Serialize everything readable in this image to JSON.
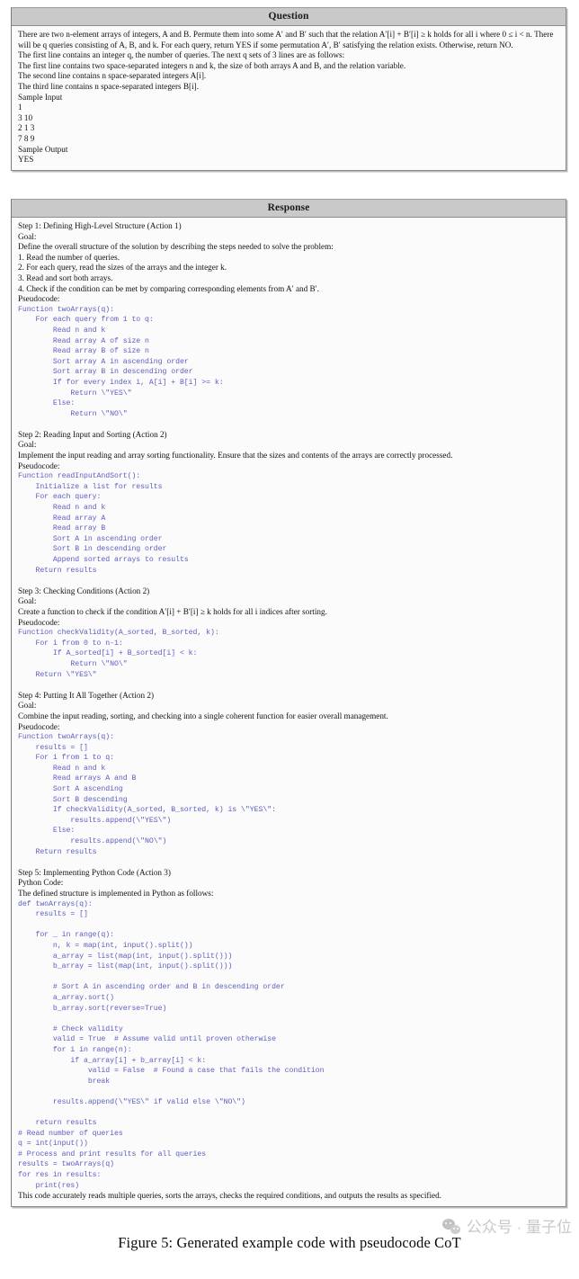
{
  "question": {
    "header": "Question",
    "paragraphs": [
      "There are two n-element arrays of integers, A and B. Permute them into some A′ and B′ such that the relation A′[i] + B′[i] ≥ k holds for all i where 0 ≤ i < n. There will be q queries consisting of A, B, and k. For each query, return YES if some permutation  A′, B′  satisfying the relation exists.  Otherwise, return NO.",
      "The first line contains an integer q, the number of queries. The next q sets of 3 lines are as follows:",
      "The first line contains two space-separated integers n and k, the size of both arrays A and B, and the relation variable.",
      "The second line contains n space-separated integers A[i].",
      "The third line contains n space-separated integers B[i]."
    ],
    "sample_input_label": "Sample Input",
    "sample_input_lines": [
      "1",
      "3 10",
      "2 1 3",
      "7 8 9"
    ],
    "sample_output_label": "Sample Output",
    "sample_output_lines": [
      "YES"
    ]
  },
  "response": {
    "header": "Response",
    "steps": [
      {
        "title": "Step 1: Defining High-Level Structure (Action 1)",
        "goal_label": "Goal:",
        "goal_lines": [
          "Define the overall structure of the solution by describing the steps needed to solve the problem:",
          "1. Read the number of queries.",
          "2. For each query, read the sizes of the arrays and the integer k.",
          "3. Read and sort both arrays.",
          "4. Check if the condition can be met by comparing corresponding elements from A′ and B′."
        ],
        "code_label": "Pseudocode:",
        "code": "Function twoArrays(q):\n    For each query from 1 to q:\n        Read n and k\n        Read array A of size n\n        Read array B of size n\n        Sort array A in ascending order\n        Sort array B in descending order\n        If for every index i, A[i] + B[i] >= k:\n            Return \\\"YES\\\"\n        Else:\n            Return \\\"NO\\\""
      },
      {
        "title": "Step 2: Reading Input and Sorting (Action 2)",
        "goal_label": "Goal:",
        "goal_lines": [
          "Implement the input reading and array sorting functionality. Ensure that the sizes and contents of the arrays are correctly processed."
        ],
        "code_label": "Pseudocode:",
        "code": "Function readInputAndSort():\n    Initialize a list for results\n    For each query:\n        Read n and k\n        Read array A\n        Read array B\n        Sort A in ascending order\n        Sort B in descending order\n        Append sorted arrays to results\n    Return results"
      },
      {
        "title": "Step 3: Checking Conditions (Action 2)",
        "goal_label": "Goal:",
        "goal_lines": [
          "Create a function to check if the condition A′[i] + B′[i] ≥ k holds for all i indices after sorting."
        ],
        "code_label": "Pseudocode:",
        "code": "Function checkValidity(A_sorted, B_sorted, k):\n    For i from 0 to n-1:\n        If A_sorted[i] + B_sorted[i] < k:\n            Return \\\"NO\\\"\n    Return \\\"YES\\\""
      },
      {
        "title": "Step 4: Putting It All Together (Action 2)",
        "goal_label": "Goal:",
        "goal_lines": [
          "Combine the input reading, sorting, and checking into a single coherent function for easier overall management."
        ],
        "code_label": "Pseudocode:",
        "code": "Function twoArrays(q):\n    results = []\n    For i from 1 to q:\n        Read n and k\n        Read arrays A and B\n        Sort A ascending\n        Sort B descending\n        If checkValidity(A_sorted, B_sorted, k) is \\\"YES\\\":\n            results.append(\\\"YES\\\")\n        Else:\n            results.append(\\\"NO\\\")\n    Return results"
      }
    ],
    "final_step": {
      "title": "Step 5: Implementing Python Code (Action 3)",
      "code_label": "Python Code:",
      "intro": "The defined structure is implemented in Python as follows:",
      "code": "def twoArrays(q):\n    results = []\n\n    for _ in range(q):\n        n, k = map(int, input().split())\n        a_array = list(map(int, input().split()))\n        b_array = list(map(int, input().split()))\n\n        # Sort A in ascending order and B in descending order\n        a_array.sort()\n        b_array.sort(reverse=True)\n\n        # Check validity\n        valid = True  # Assume valid until proven otherwise\n        for i in range(n):\n            if a_array[i] + b_array[i] < k:\n                valid = False  # Found a case that fails the condition\n                break\n\n        results.append(\\\"YES\\\" if valid else \\\"NO\\\")\n\n    return results",
      "code_tail": "# Read number of queries\nq = int(input())\n# Process and print results for all queries\nresults = twoArrays(q)\nfor res in results:\n    print(res)",
      "closing": "This code accurately reads multiple queries, sorts the arrays, checks the required conditions, and outputs the results as specified."
    }
  },
  "caption": "Figure 5: Generated example code with pseudocode CoT",
  "watermark": {
    "text": "公众号 · 量子位",
    "icon": "wechat-logo-icon"
  },
  "colors": {
    "code_text": "#5d5dc4",
    "header_bg": "#c9c9c9",
    "panel_bg": "#fbfbfb",
    "border": "#8d8d8d"
  }
}
